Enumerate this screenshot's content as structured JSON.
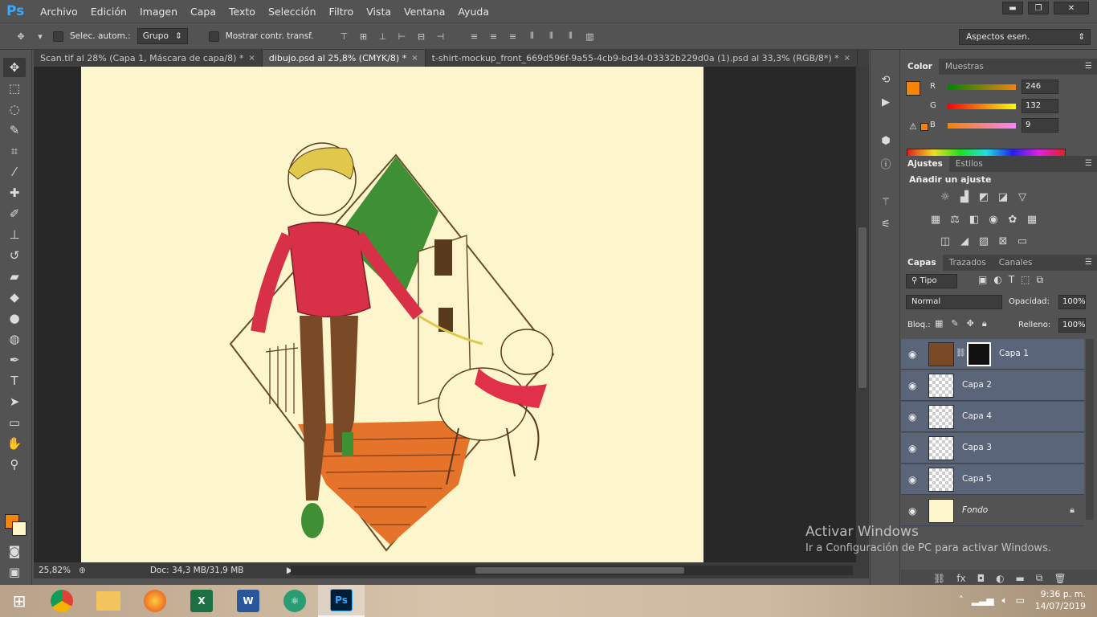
{
  "app": {
    "logo": "Ps"
  },
  "menu": [
    "Archivo",
    "Edición",
    "Imagen",
    "Capa",
    "Texto",
    "Selección",
    "Filtro",
    "Vista",
    "Ventana",
    "Ayuda"
  ],
  "window_controls": {
    "minimize": "▬",
    "restore": "❐",
    "close": "✕"
  },
  "options": {
    "auto_select_label": "Selec. autom.:",
    "auto_select_target": "Grupo",
    "show_transform_label": "Mostrar contr. transf.",
    "workspace": "Aspectos esen."
  },
  "tabs": [
    {
      "label": "Scan.tif al 28% (Capa 1, Máscara de capa/8) *",
      "close": "×"
    },
    {
      "label": "dibujo.psd al 25,8% (CMYK/8) *",
      "close": "×"
    },
    {
      "label": "t-shirt-mockup_front_669d596f-9a55-4cb9-bd34-03332b229d0a (1).psd al 33,3% (RGB/8*) *",
      "close": "×"
    }
  ],
  "status": {
    "zoom": "25,82%",
    "doc": "Doc: 34,3 MB/31,9 MB"
  },
  "colors": {
    "foreground": "#f68409",
    "background": "#fdf5c8",
    "canvas": "#fdf6cd"
  },
  "color_panel": {
    "tabs": [
      "Color",
      "Muestras"
    ],
    "channels": [
      {
        "label": "R",
        "value": "246"
      },
      {
        "label": "G",
        "value": "132"
      },
      {
        "label": "B",
        "value": "9"
      }
    ]
  },
  "adjust_panel": {
    "tabs": [
      "Ajustes",
      "Estilos"
    ],
    "title": "Añadir un ajuste"
  },
  "layers_panel": {
    "tabs": [
      "Capas",
      "Trazados",
      "Canales"
    ],
    "filter": "Tipo",
    "blend_mode": "Normal",
    "opacity_label": "Opacidad:",
    "opacity": "100%",
    "lock_label": "Bloq.:",
    "fill_label": "Relleno:",
    "fill": "100%",
    "layers": [
      {
        "name": "Capa 1"
      },
      {
        "name": "Capa 2"
      },
      {
        "name": "Capa 4"
      },
      {
        "name": "Capa 3"
      },
      {
        "name": "Capa 5"
      },
      {
        "name": "Fondo"
      }
    ]
  },
  "watermark": {
    "title": "Activar Windows",
    "subtitle": "Ir a Configuración de PC para activar Windows."
  },
  "taskbar": {
    "time": "9:36 p. m.",
    "date": "14/07/2019"
  }
}
